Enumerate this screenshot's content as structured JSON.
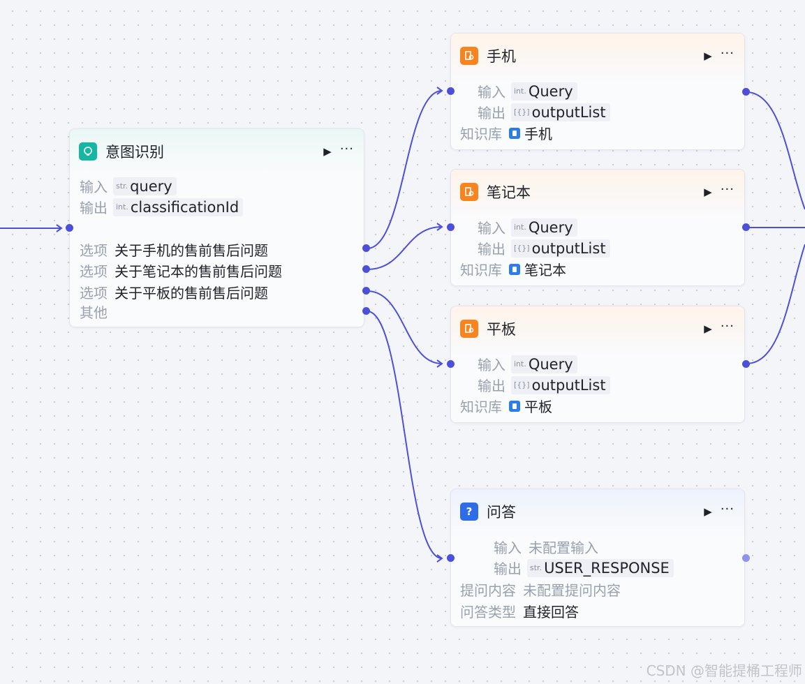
{
  "colors": {
    "edge": "#4c50d9",
    "canvas": "#f4f5f8",
    "kb_icon": "#f7841f",
    "intent_icon": "#16b6a3",
    "qa_icon": "#2f6de8"
  },
  "intent_node": {
    "title": "意图识别",
    "icon": "bulb-icon",
    "input_label": "输入",
    "input_type": "str.",
    "input_value": "query",
    "output_label": "输出",
    "output_type": "int.",
    "output_value": "classificationId",
    "options": [
      {
        "label": "选项",
        "text": "关于手机的售前售后问题"
      },
      {
        "label": "选项",
        "text": "关于笔记本的售前售后问题"
      },
      {
        "label": "选项",
        "text": "关于平板的售前售后问题"
      }
    ],
    "other_label": "其他"
  },
  "kb_nodes": [
    {
      "title": "手机",
      "input_label": "输入",
      "input_type": "int.",
      "input_value": "Query",
      "output_label": "输出",
      "output_type": "[{}]",
      "output_value": "outputList",
      "kb_label": "知识库",
      "kb_value": "手机"
    },
    {
      "title": "笔记本",
      "input_label": "输入",
      "input_type": "int.",
      "input_value": "Query",
      "output_label": "输出",
      "output_type": "[{}]",
      "output_value": "outputList",
      "kb_label": "知识库",
      "kb_value": "笔记本"
    },
    {
      "title": "平板",
      "input_label": "输入",
      "input_type": "int.",
      "input_value": "Query",
      "output_label": "输出",
      "output_type": "[{}]",
      "output_value": "outputList",
      "kb_label": "知识库",
      "kb_value": "平板"
    }
  ],
  "qa_node": {
    "title": "问答",
    "icon": "question-icon",
    "input_label": "输入",
    "input_value": "未配置输入",
    "output_label": "输出",
    "output_type": "str.",
    "output_value": "USER_RESPONSE",
    "question_label": "提问内容",
    "question_value": "未配置提问内容",
    "answer_type_label": "问答类型",
    "answer_type_value": "直接回答"
  },
  "controls": {
    "run_glyph": "▶",
    "more_glyph": "···"
  },
  "watermark": "CSDN @智能提桶工程师"
}
